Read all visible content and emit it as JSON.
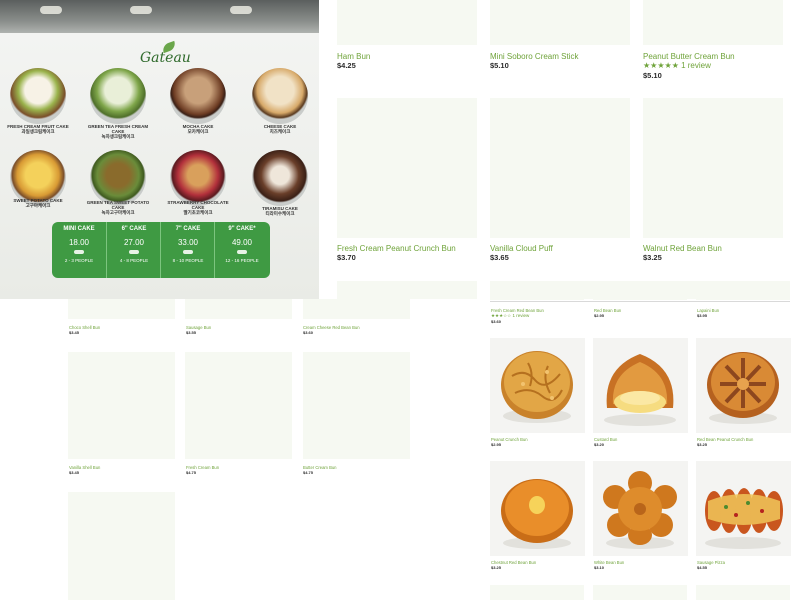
{
  "photo": {
    "brand": "Gateau",
    "cakes_row1": [
      {
        "en": "FRESH CREAM FRUIT CAKE",
        "ko": "과일생크림케이크"
      },
      {
        "en": "GREEN TEA FRESH CREAM CAKE",
        "ko": "녹차생크림케이크"
      },
      {
        "en": "MOCHA CAKE",
        "ko": "모카케이크"
      },
      {
        "en": "CHEESE CAKE",
        "ko": "치즈케이크"
      }
    ],
    "cakes_row2": [
      {
        "en": "SWEET POTATO CAKE",
        "ko": "고구마케이크"
      },
      {
        "en": "GREEN TEA SWEET POTATO CAKE",
        "ko": "녹차고구마케이크"
      },
      {
        "en": "STRAWBERRY CHOCOLATE CAKE",
        "ko": "딸기초코케이크"
      },
      {
        "en": "TIRAMISU CAKE",
        "ko": "티라미수케이크"
      }
    ],
    "sizes": [
      {
        "size": "MINI CAKE",
        "price": "18.00",
        "people": "2 - 3 PEOPLE"
      },
      {
        "size": "6\" CAKE",
        "price": "27.00",
        "people": "4 - 8 PEOPLE"
      },
      {
        "size": "7\" CAKE",
        "price": "33.00",
        "people": "8 - 10 PEOPLE"
      },
      {
        "size": "9\" CAKE*",
        "price": "49.00",
        "people": "12 - 16 PEOPLE"
      }
    ]
  },
  "top_products": [
    {
      "name": "Ham Bun",
      "price": "$4.25"
    },
    {
      "name": "Mini Soboro Cream Stick",
      "price": "$5.10"
    },
    {
      "name": "Peanut Butter Cream Bun",
      "price": "$5.10",
      "stars": "★★★★★",
      "reviews": "1 review"
    },
    {
      "name": "Fresh Cream Peanut Crunch Bun",
      "price": "$3.70"
    },
    {
      "name": "Vanilla Cloud Puff",
      "price": "$3.65"
    },
    {
      "name": "Walnut Red Bean Bun",
      "price": "$3.25"
    }
  ],
  "left_products": [
    {
      "name": "Choco Shell Bun",
      "price": "$3.45"
    },
    {
      "name": "Sausage Bun",
      "price": "$3.55"
    },
    {
      "name": "Cream Cheese Red Bean Bun",
      "price": "$3.60"
    },
    {
      "name": "Vanilla Shell Bun",
      "price": "$3.45"
    },
    {
      "name": "Fresh Cream Bun",
      "price": "$4.75"
    },
    {
      "name": "Butter Cream Bun",
      "price": "$4.75"
    }
  ],
  "right_products": [
    {
      "name": "Fresh Cream Red Bean Bun",
      "price": "$3.60",
      "stars": "★★★☆☆",
      "reviews": "1 review"
    },
    {
      "name": "Red Bean Bun",
      "price": "$2.95"
    },
    {
      "name": "Lapaini Bun",
      "price": "$3.95"
    },
    {
      "name": "Peanut Crunch Bun",
      "price": "$2.95"
    },
    {
      "name": "Custard Bun",
      "price": "$3.20"
    },
    {
      "name": "Red Bean Peanut Crunch Bun",
      "price": "$3.25"
    },
    {
      "name": "Chestnut Red Bean Bun",
      "price": "$3.25"
    },
    {
      "name": "White Bean Bun",
      "price": "$3.10"
    },
    {
      "name": "Sausage Pizza",
      "price": "$4.55"
    }
  ],
  "colors": {
    "accent": "#6fa33a",
    "placeholder": "#f6f9f2",
    "price": "#2b2b2b"
  }
}
